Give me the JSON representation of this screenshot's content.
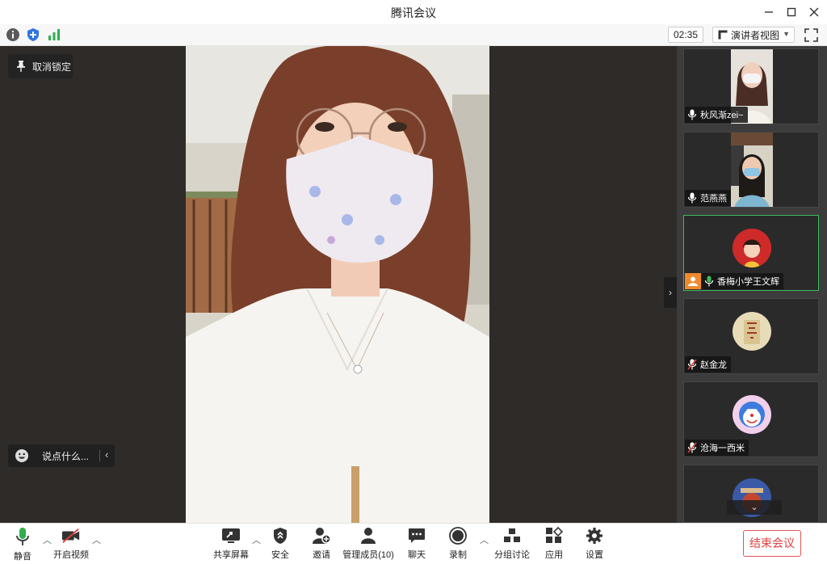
{
  "window": {
    "title": "腾讯会议"
  },
  "infobar": {
    "timer": "02:35",
    "view_mode": "演讲者视图"
  },
  "stage": {
    "pin_label": "取消锁定",
    "chat_placeholder": "说点什么..."
  },
  "participants": [
    {
      "name": "秋风渐zei~",
      "mic": "on"
    },
    {
      "name": "范燕燕",
      "mic": "on"
    },
    {
      "name": "香梅小学王文辉",
      "mic": "on",
      "host": true
    },
    {
      "name": "赵金龙",
      "mic": "muted"
    },
    {
      "name": "沧海一西米",
      "mic": "muted"
    }
  ],
  "toolbar": {
    "mute": "静音",
    "video": "开启视频",
    "share": "共享屏幕",
    "security": "安全",
    "invite": "邀请",
    "members": "管理成员(10)",
    "chat": "聊天",
    "record": "录制",
    "breakout": "分组讨论",
    "apps": "应用",
    "settings": "设置",
    "end": "结束会议"
  },
  "colors": {
    "accent_green": "#3cba5a",
    "end_red": "#e04040",
    "host_orange": "#f08a2c"
  }
}
